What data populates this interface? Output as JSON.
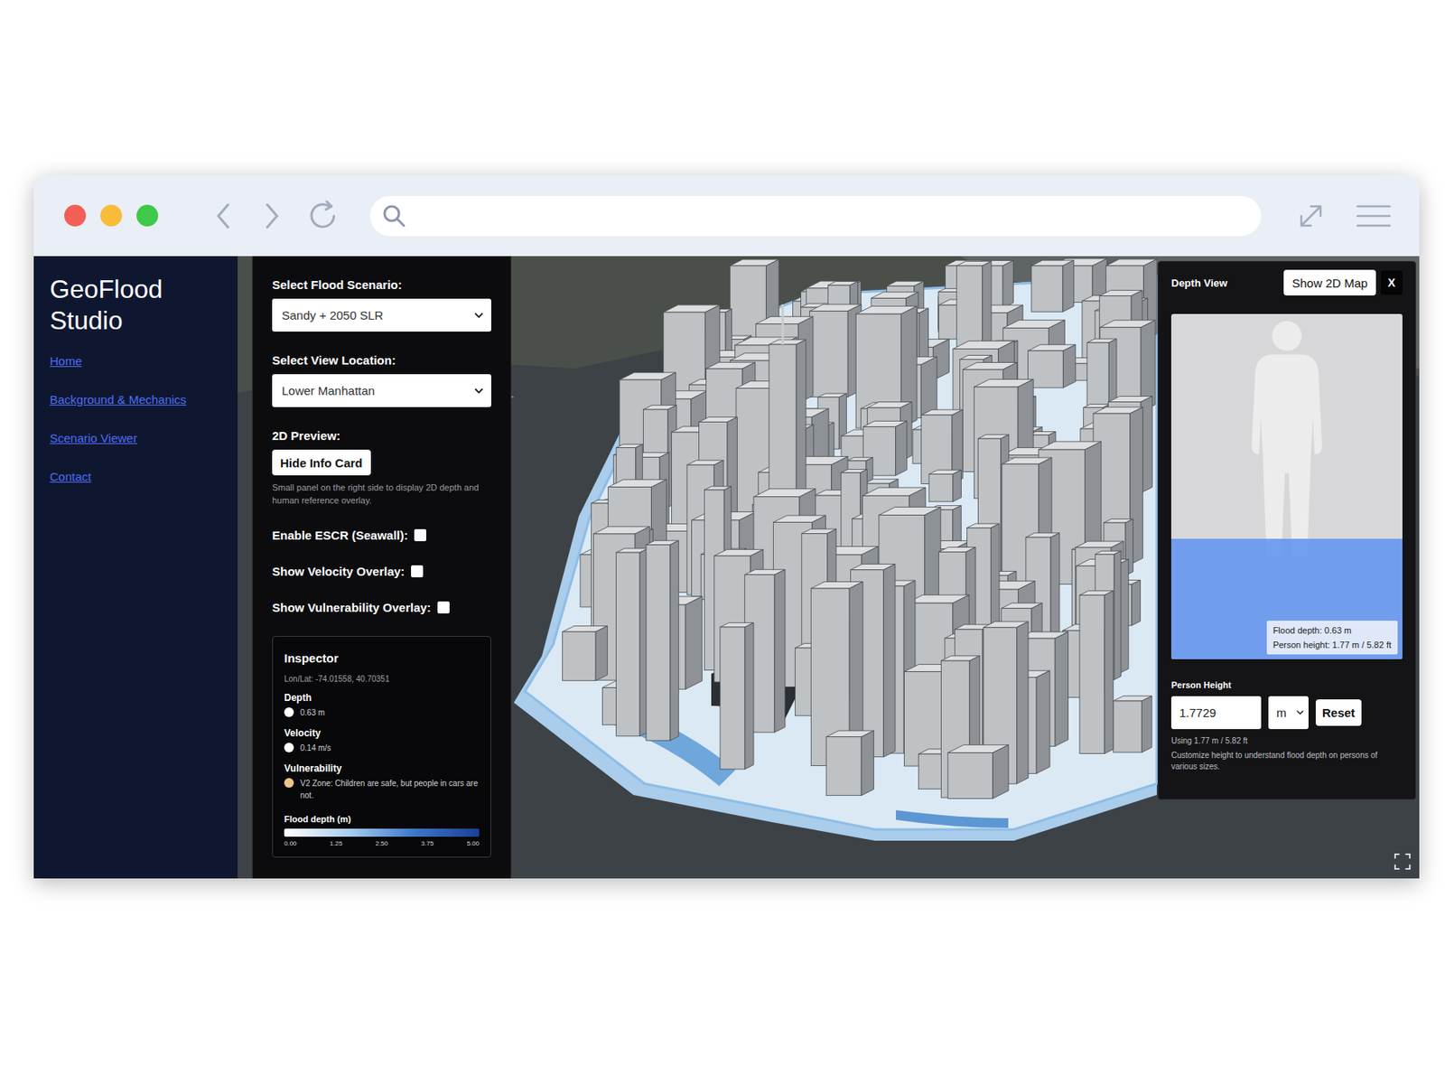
{
  "app": {
    "title": "GeoFlood Studio"
  },
  "nav": [
    {
      "label": "Home"
    },
    {
      "label": "Background & Mechanics"
    },
    {
      "label": "Scenario Viewer"
    },
    {
      "label": "Contact"
    }
  ],
  "controls": {
    "scenario": {
      "label": "Select Flood Scenario:",
      "value": "Sandy + 2050 SLR"
    },
    "location": {
      "label": "Select View Location:",
      "value": "Lower Manhattan"
    },
    "preview": {
      "label": "2D Preview:",
      "button": "Hide Info Card",
      "hint": "Small panel on the right side to display 2D depth and human reference overlay."
    },
    "toggles": [
      {
        "label": "Enable ESCR (Seawall):",
        "checked": false
      },
      {
        "label": "Show Velocity Overlay:",
        "checked": false
      },
      {
        "label": "Show Vulnerability Overlay:",
        "checked": false
      }
    ]
  },
  "inspector": {
    "title": "Inspector",
    "coords": "Lon/Lat: -74.01558, 40.70351",
    "metrics": [
      {
        "label": "Depth",
        "value": "0.63 m",
        "color": "#ffffff"
      },
      {
        "label": "Velocity",
        "value": "0.14 m/s",
        "color": "#ffffff"
      },
      {
        "label": "Vulnerability",
        "value": "V2 Zone: Children are safe, but people in cars are not.",
        "color": "#f3c38c"
      }
    ],
    "legend": {
      "title": "Flood depth (m)",
      "ticks": [
        "0.00",
        "1.25",
        "2.50",
        "3.75",
        "5.00"
      ]
    }
  },
  "depth_view": {
    "title": "Depth View",
    "map_button": "Show 2D Map",
    "close": "X",
    "level": 0.35,
    "readout": [
      "Flood depth: 0.63 m",
      "Person height: 1.77 m / 5.82 ft"
    ],
    "height_label": "Person Height",
    "height_value": "1.7729",
    "unit": "m",
    "reset": "Reset",
    "using": "Using 1.77 m / 5.82 ft",
    "hint": "Customize height to understand flood depth on persons of various sizes."
  }
}
